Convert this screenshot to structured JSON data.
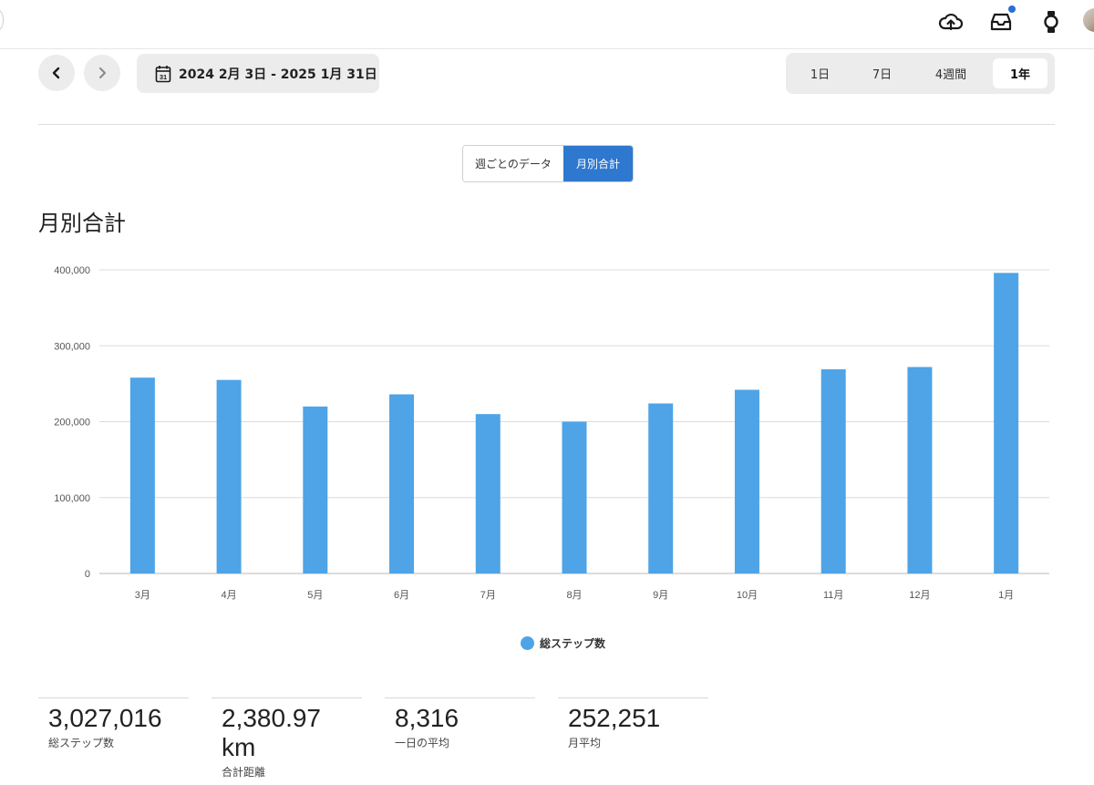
{
  "topbar": {
    "icons": [
      "cloud-upload-icon",
      "inbox-icon",
      "watch-icon"
    ],
    "notification_color": "#2a6fd6"
  },
  "date_nav": {
    "prev_icon": "chevron-left-icon",
    "next_icon": "chevron-right-icon",
    "calendar_day": "31",
    "range_label": "2024 2月 3日 - 2025 1月 31日"
  },
  "range_options": [
    {
      "label": "1日",
      "active": false
    },
    {
      "label": "7日",
      "active": false
    },
    {
      "label": "4週間",
      "active": false
    },
    {
      "label": "1年",
      "active": true
    }
  ],
  "view_toggle": {
    "weekly_label": "週ごとのデータ",
    "monthly_label": "月別合計",
    "active": "monthly"
  },
  "section_title": "月別合計",
  "chart_data": {
    "type": "bar",
    "categories": [
      "3月",
      "4月",
      "5月",
      "6月",
      "7月",
      "8月",
      "9月",
      "10月",
      "11月",
      "12月",
      "1月"
    ],
    "series": [
      {
        "name": "総ステップ数",
        "values": [
          258000,
          255000,
          220000,
          236000,
          210000,
          200000,
          224000,
          242000,
          269000,
          272000,
          396000
        ],
        "color": "#4ea4e6"
      }
    ],
    "ylim": [
      0,
      400000
    ],
    "yticks": [
      "0",
      "100,000",
      "200,000",
      "300,000",
      "400,000"
    ],
    "grid": true,
    "legend": "bottom-center"
  },
  "stats": [
    {
      "value": "3,027,016",
      "label": "総ステップ数"
    },
    {
      "value": "2,380.97 km",
      "label": "合計距離"
    },
    {
      "value": "8,316",
      "label": "一日の平均"
    },
    {
      "value": "252,251",
      "label": "月平均"
    }
  ]
}
